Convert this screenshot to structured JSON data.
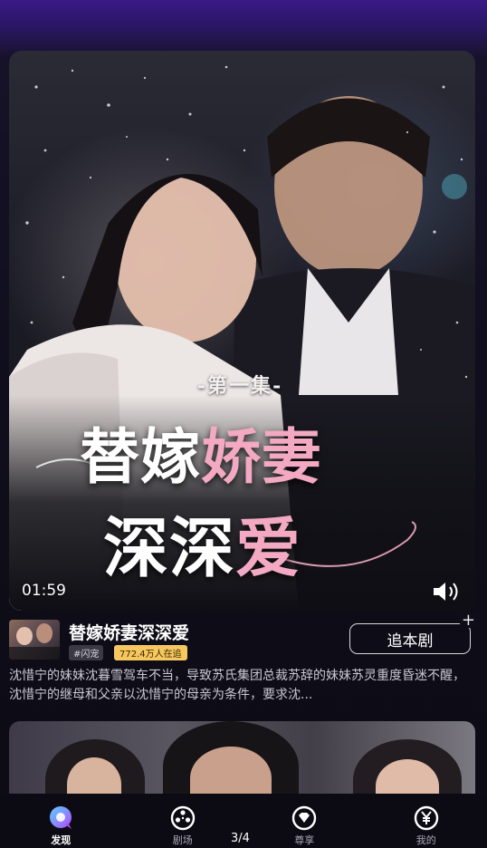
{
  "video": {
    "episode_badge": "-第一集-",
    "poster_title_white_1": "替嫁",
    "poster_title_pink_1": "娇妻",
    "poster_title_white_2": "深深",
    "poster_title_pink_2": "爱",
    "timecode": "01:59",
    "volume_icon": "speaker-icon"
  },
  "drama": {
    "title": "替嫁娇妻深深爱",
    "genre_tag": "#闪宠",
    "followers_tag": "772.4万人在追",
    "follow_button": "追本剧",
    "follow_plus": "+",
    "description": "沈惜宁的妹妹沈暮雪驾车不当，导致苏氏集团总裁苏辞的妹妹苏灵重度昏迷不醒，沈惜宁的继母和父亲以沈惜宁的母亲为条件，要求沈..."
  },
  "nav": {
    "items": [
      {
        "label": "发现",
        "icon": "discover-icon",
        "active": true
      },
      {
        "label": "剧场",
        "icon": "film-reel-icon",
        "active": false
      },
      {
        "label": "尊享",
        "icon": "diamond-icon",
        "active": false
      },
      {
        "label": "我的",
        "icon": "yen-icon",
        "active": false
      }
    ],
    "page_indicator": "3/4"
  },
  "colors": {
    "accent_pink": "#f2a9c1",
    "followers_tag_bg": "#f6c75e",
    "discover_gradient_start": "#5ad0ff",
    "discover_gradient_end": "#b04dff"
  }
}
